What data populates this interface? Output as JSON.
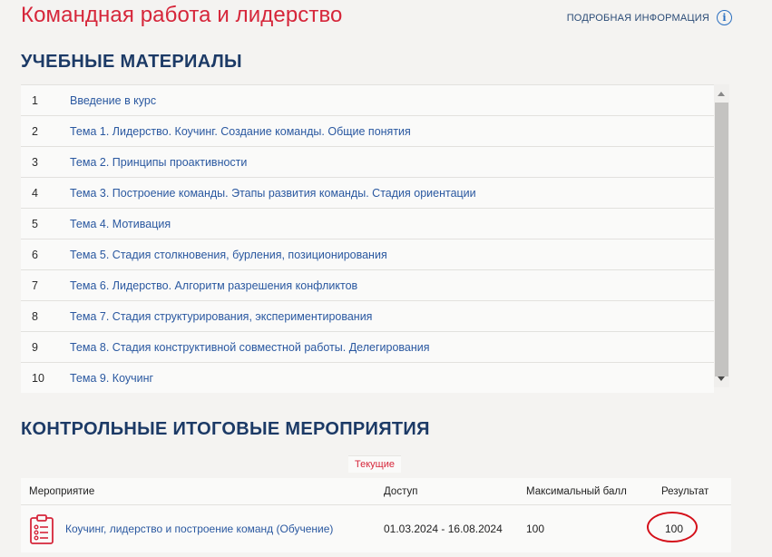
{
  "header": {
    "title": "Командная работа и лидерство",
    "more_info_label": "ПОДРОБНАЯ ИНФОРМАЦИЯ",
    "info_icon": "info-circle-icon"
  },
  "materials": {
    "section_title": "УЧЕБНЫЕ МАТЕРИАЛЫ",
    "items": [
      {
        "num": "1",
        "label": "Введение в курс"
      },
      {
        "num": "2",
        "label": "Тема 1. Лидерство. Коучинг. Создание команды. Общие понятия"
      },
      {
        "num": "3",
        "label": "Тема 2. Принципы проактивности"
      },
      {
        "num": "4",
        "label": "Тема 3. Построение команды. Этапы развития команды. Стадия ориентации"
      },
      {
        "num": "5",
        "label": "Тема 4. Мотивация"
      },
      {
        "num": "6",
        "label": "Тема 5. Стадия столкновения, бурления, позиционирования"
      },
      {
        "num": "7",
        "label": "Тема 6. Лидерство. Алгоритм разрешения конфликтов"
      },
      {
        "num": "8",
        "label": "Тема 7. Стадия структурирования, экспериментирования"
      },
      {
        "num": "9",
        "label": "Тема 8. Стадия конструктивной совместной работы. Делегирования"
      },
      {
        "num": "10",
        "label": "Тема 9. Коучинг"
      }
    ]
  },
  "events": {
    "section_title": "КОНТРОЛЬНЫЕ ИТОГОВЫЕ МЕРОПРИЯТИЯ",
    "tab_current": "Текущие",
    "columns": {
      "event": "Мероприятие",
      "access": "Доступ",
      "max_score": "Максимальный балл",
      "result": "Результат"
    },
    "rows": [
      {
        "icon": "checklist-clipboard-icon",
        "event": "Коучинг, лидерство и построение команд (Обучение)",
        "access": "01.03.2024 - 16.08.2024",
        "max_score": "100",
        "result": "100"
      }
    ]
  },
  "colors": {
    "title_red": "#d6263a",
    "heading_navy": "#1c3a66",
    "link_blue": "#2a58a0",
    "highlight_red": "#d4101a"
  }
}
